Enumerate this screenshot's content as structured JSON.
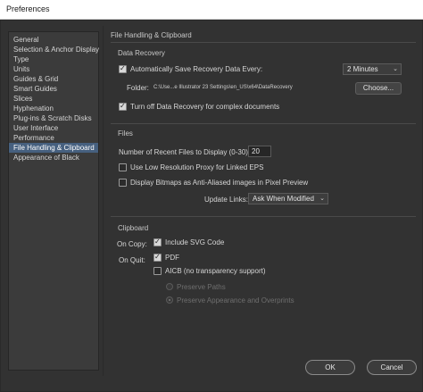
{
  "window": {
    "title": "Preferences"
  },
  "sidebar": {
    "items": [
      {
        "label": "General"
      },
      {
        "label": "Selection & Anchor Display"
      },
      {
        "label": "Type"
      },
      {
        "label": "Units"
      },
      {
        "label": "Guides & Grid"
      },
      {
        "label": "Smart Guides"
      },
      {
        "label": "Slices"
      },
      {
        "label": "Hyphenation"
      },
      {
        "label": "Plug-ins & Scratch Disks"
      },
      {
        "label": "User Interface"
      },
      {
        "label": "Performance"
      },
      {
        "label": "File Handling & Clipboard",
        "selected": true
      },
      {
        "label": "Appearance of Black"
      }
    ]
  },
  "panel": {
    "title": "File Handling & Clipboard",
    "data_recovery": {
      "heading": "Data Recovery",
      "auto_save": {
        "label": "Automatically Save Recovery Data Every:",
        "checked": true
      },
      "interval": {
        "value": "2 Minutes"
      },
      "folder": {
        "label": "Folder:",
        "path": "C:\\Use...e Illustrator 23 Settings\\en_US\\x64\\DataRecovery"
      },
      "choose_button": "Choose...",
      "turn_off": {
        "label": "Turn off Data Recovery for complex documents",
        "checked": true
      }
    },
    "files": {
      "heading": "Files",
      "recent_files": {
        "label": "Number of Recent Files to Display (0-30):",
        "value": "20"
      },
      "low_res_proxy": {
        "label": "Use Low Resolution Proxy for Linked EPS",
        "checked": false
      },
      "display_bitmaps": {
        "label": "Display Bitmaps as Anti-Aliased images in Pixel Preview",
        "checked": false
      },
      "update_links": {
        "label": "Update Links:",
        "value": "Ask When Modified"
      }
    },
    "clipboard": {
      "heading": "Clipboard",
      "on_copy": {
        "label": "On Copy:",
        "svg_code": {
          "label": "Include SVG Code",
          "checked": true
        }
      },
      "on_quit": {
        "label": "On Quit:",
        "pdf": {
          "label": "PDF",
          "checked": true
        },
        "aicb": {
          "label": "AICB (no transparency support)",
          "checked": false
        },
        "preserve_paths": {
          "label": "Preserve Paths"
        },
        "preserve_appearance": {
          "label": "Preserve Appearance and Overprints"
        }
      }
    }
  },
  "footer": {
    "ok": "OK",
    "cancel": "Cancel"
  }
}
